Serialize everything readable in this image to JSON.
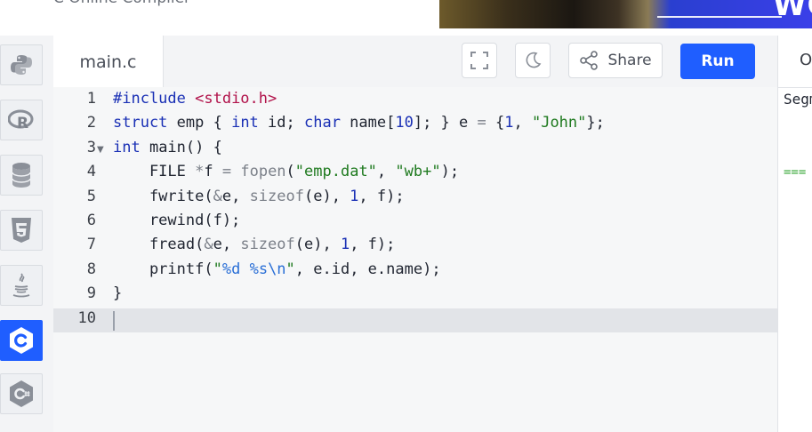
{
  "site": {
    "title": "C Online Compiler"
  },
  "ad": {
    "text": "WO"
  },
  "sidebar": {
    "languages": [
      {
        "icon": "python-icon",
        "active": false
      },
      {
        "icon": "r-icon",
        "active": false
      },
      {
        "icon": "database-icon",
        "active": false
      },
      {
        "icon": "html5-icon",
        "active": false
      },
      {
        "icon": "java-icon",
        "active": false
      },
      {
        "icon": "c-icon",
        "active": true
      },
      {
        "icon": "csharp-icon",
        "active": false
      }
    ]
  },
  "editor": {
    "tab_label": "main.c",
    "share_label": "Share",
    "run_label": "Run",
    "line_numbers": [
      "1",
      "2",
      "3",
      "4",
      "5",
      "6",
      "7",
      "8",
      "9",
      "10"
    ],
    "code": [
      "#include <stdio.h>",
      "struct emp { int id; char name[10]; } e = {1, \"John\"};",
      "int main() {",
      "    FILE *f = fopen(\"emp.dat\", \"wb+\");",
      "    fwrite(&e, sizeof(e), 1, f);",
      "    rewind(f);",
      "    fread(&e, sizeof(e), 1, f);",
      "    printf(\"%d %s\\n\", e.id, e.name);",
      "}",
      ""
    ]
  },
  "output": {
    "label": "Output",
    "text": "Segmentation fault",
    "separator": "=== Code Exited With Errors ==="
  },
  "colors": {
    "accent": "#1f5eff",
    "keyword": "#1a30b5",
    "string": "#1f7a1f",
    "include": "#b1124a"
  }
}
